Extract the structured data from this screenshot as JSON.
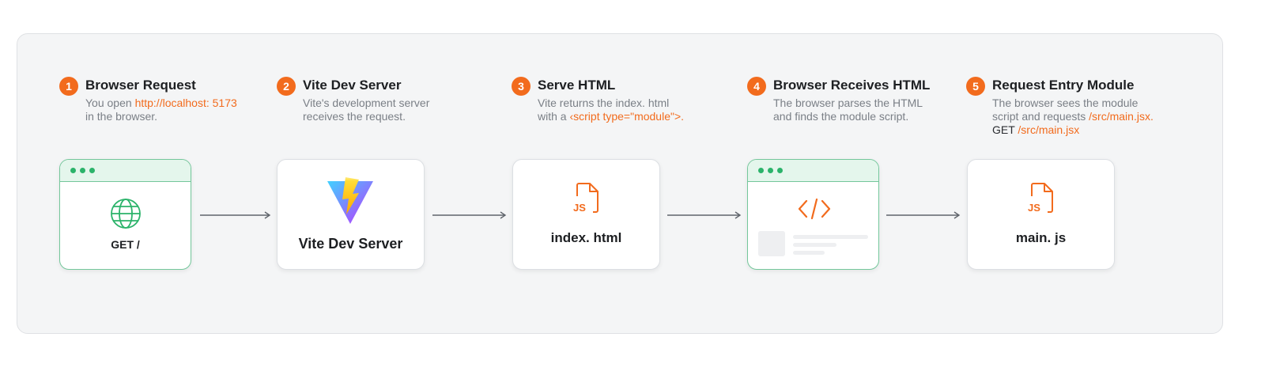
{
  "steps": [
    {
      "num": "1",
      "title": "Browser Request",
      "desc": [
        {
          "t": "You open ",
          "c": ""
        },
        {
          "t": "http://localhost: 5173",
          "c": "hl"
        },
        {
          "t": "\nin the browser.",
          "c": ""
        }
      ]
    },
    {
      "num": "2",
      "title": "Vite Dev Server",
      "desc": [
        {
          "t": "Vite's development server\nreceives the request.",
          "c": ""
        }
      ]
    },
    {
      "num": "3",
      "title": "Serve HTML",
      "desc": [
        {
          "t": "Vite returns the index. html\nwith a ",
          "c": ""
        },
        {
          "t": "‹script type=\"module\">.",
          "c": "hl"
        }
      ]
    },
    {
      "num": "4",
      "title": "Browser Receives HTML",
      "desc": [
        {
          "t": "The browser parses the HTML\nand finds the module script.",
          "c": ""
        }
      ]
    },
    {
      "num": "5",
      "title": "Request Entry Module",
      "desc": [
        {
          "t": "The browser sees the module\nscript and requests ",
          "c": ""
        },
        {
          "t": "/src/main.jsx.",
          "c": "hl"
        },
        {
          "t": "\nGET ",
          "c": "dk"
        },
        {
          "t": "/src/main.jsx",
          "c": "hl"
        }
      ]
    }
  ],
  "cards": {
    "browser_request": {
      "label": "GET /",
      "icon": "globe-icon"
    },
    "vite_server": {
      "label": "Vite Dev Server",
      "icon": "vite-logo"
    },
    "index_html": {
      "label": "index. html",
      "icon": "js-file-icon",
      "icon_text": "JS"
    },
    "browser_receives": {
      "icon": "code-icon"
    },
    "main_js": {
      "label": "main. js",
      "icon": "js-file-icon",
      "icon_text": "JS"
    }
  },
  "colors": {
    "accent": "#f26b1d",
    "browser_green": "#2bb36a",
    "panel_bg": "#f4f5f6"
  }
}
